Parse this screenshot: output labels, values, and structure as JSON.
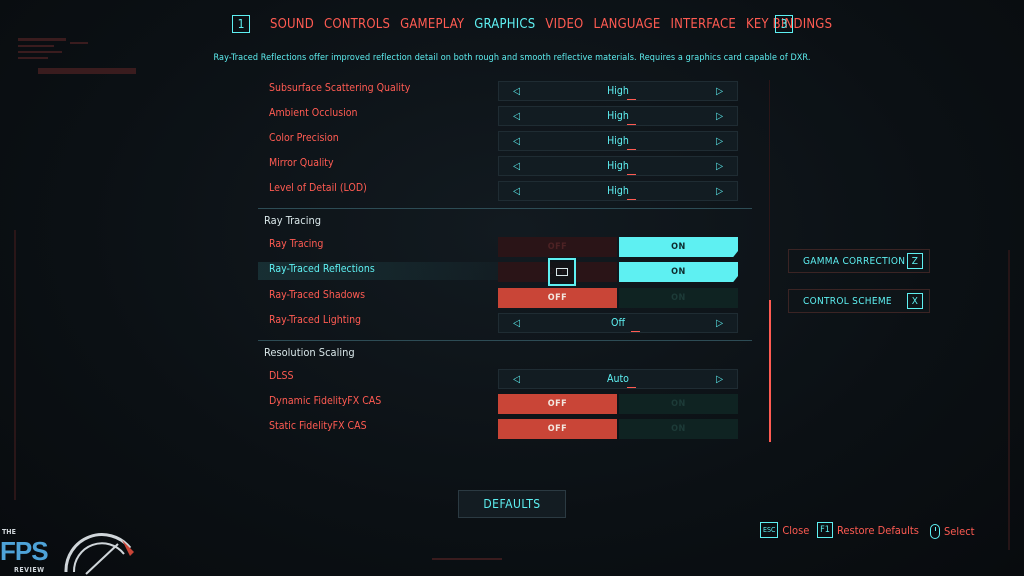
{
  "nav": {
    "left_key": "1",
    "right_key": "3",
    "tabs": [
      "SOUND",
      "CONTROLS",
      "GAMEPLAY",
      "GRAPHICS",
      "VIDEO",
      "LANGUAGE",
      "INTERFACE",
      "KEY BINDINGS"
    ],
    "active_tab": "GRAPHICS"
  },
  "description": "Ray-Traced Reflections offer improved reflection detail on both rough and smooth reflective materials. Requires a graphics card capable of DXR.",
  "rows_quality": [
    {
      "label": "Subsurface Scattering Quality",
      "value": "High"
    },
    {
      "label": "Ambient Occlusion",
      "value": "High"
    },
    {
      "label": "Color Precision",
      "value": "High"
    },
    {
      "label": "Mirror Quality",
      "value": "High"
    },
    {
      "label": "Level of Detail (LOD)",
      "value": "High"
    }
  ],
  "section_ray_tracing": "Ray Tracing",
  "rows_ray_tracing": [
    {
      "label": "Ray Tracing",
      "off": "OFF",
      "on": "ON",
      "state": "on"
    },
    {
      "label": "Ray-Traced Reflections",
      "off": "OFF",
      "on": "ON",
      "state": "on"
    },
    {
      "label": "Ray-Traced Shadows",
      "off": "OFF",
      "on": "ON",
      "state": "off"
    },
    {
      "label": "Ray-Traced Lighting",
      "value": "Off"
    }
  ],
  "section_resolution": "Resolution Scaling",
  "rows_resolution": [
    {
      "label": "DLSS",
      "value": "Auto"
    },
    {
      "label": "Dynamic FidelityFX CAS",
      "off": "OFF",
      "on": "ON",
      "state": "off"
    },
    {
      "label": "Static FidelityFX CAS",
      "off": "OFF",
      "on": "ON",
      "state": "off"
    }
  ],
  "side_buttons": {
    "gamma": {
      "label": "GAMMA CORRECTION",
      "key": "Z"
    },
    "scheme": {
      "label": "CONTROL SCHEME",
      "key": "X"
    }
  },
  "defaults_label": "DEFAULTS",
  "footer": {
    "close": {
      "key": "ESC",
      "label": "Close"
    },
    "restore": {
      "key": "F1",
      "label": "Restore Defaults"
    },
    "select": {
      "label": "Select"
    }
  },
  "logo": {
    "the": "THE",
    "fps": "FPS",
    "review": "REVIEW"
  },
  "colors": {
    "accent_cyan": "#5ef0f2",
    "accent_red": "#ff5b52",
    "off_red": "#c94537"
  }
}
